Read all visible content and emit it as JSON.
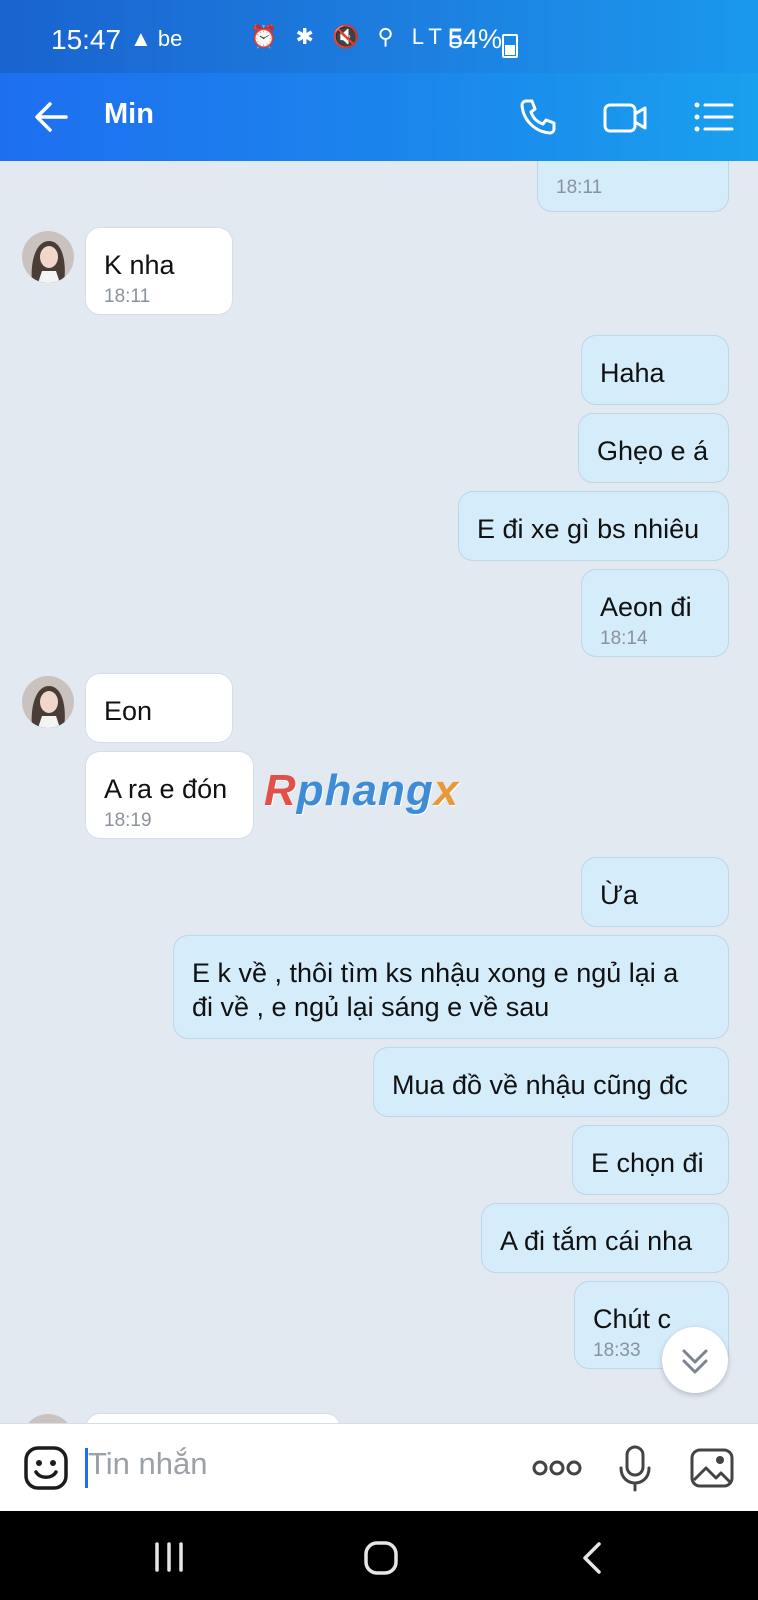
{
  "status_bar": {
    "time": "15:47",
    "left_icons": "▲ be",
    "right_icons": "⏰ ✱ 🔇 ⚲ LTE",
    "battery": "54%"
  },
  "header": {
    "title": "Min"
  },
  "messages": [
    {
      "side": "out",
      "text": "",
      "time": "18:11"
    },
    {
      "side": "in",
      "text": "K nha",
      "time": "18:11"
    },
    {
      "side": "out",
      "text": "Haha",
      "time": ""
    },
    {
      "side": "out",
      "text": "Ghẹo e á",
      "time": ""
    },
    {
      "side": "out",
      "text": "E đi xe gì bs nhiêu",
      "time": ""
    },
    {
      "side": "out",
      "text": "Aeon đi",
      "time": "18:14"
    },
    {
      "side": "in",
      "text": "Eon",
      "time": ""
    },
    {
      "side": "in",
      "text": "A ra e đón",
      "time": "18:19"
    },
    {
      "side": "out",
      "text": "Ừa",
      "time": ""
    },
    {
      "side": "out",
      "text": "E k về , thôi tìm ks nhậu xong e ngủ lại a\nđi về , e ngủ lại sáng e về sau",
      "time": ""
    },
    {
      "side": "out",
      "text": "Mua đồ về nhậu cũng đc",
      "time": ""
    },
    {
      "side": "out",
      "text": "E chọn đi",
      "time": ""
    },
    {
      "side": "out",
      "text": "A đi tắm cái nha",
      "time": ""
    },
    {
      "side": "out",
      "text": "Chút c",
      "time": "18:33"
    }
  ],
  "watermark": {
    "part1": "R",
    "part2": "phang",
    "part3": "x"
  },
  "input": {
    "placeholder": "Tin nhắn",
    "more_label": "ooo"
  },
  "colors": {
    "accent": "#1e6ff0",
    "bg": "#e2e9f1",
    "bubble_out": "#d5ecfb",
    "bubble_in": "#ffffff"
  }
}
